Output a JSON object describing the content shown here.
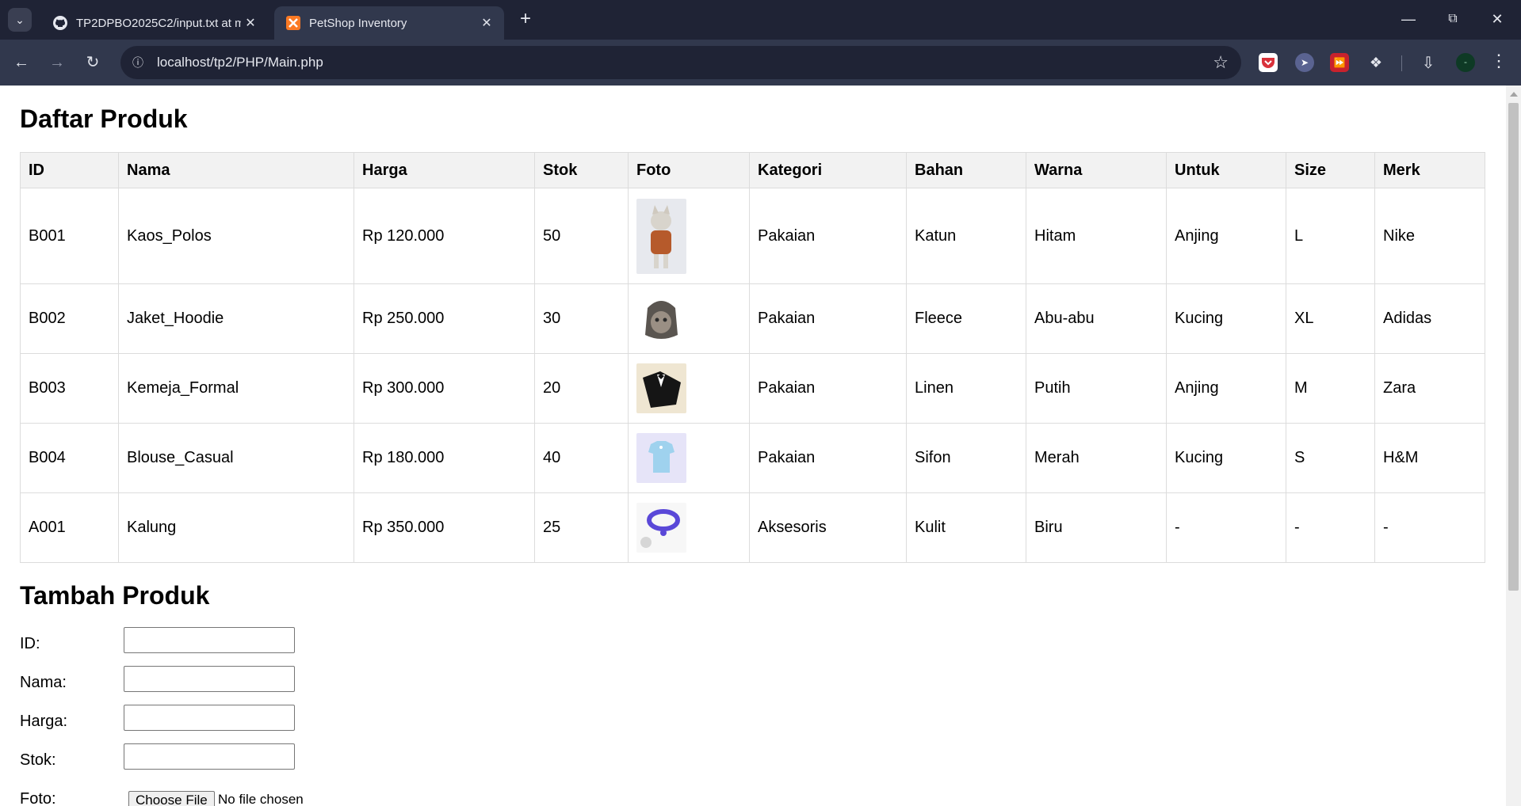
{
  "browser": {
    "tabs": [
      {
        "title": "TP2DPBO2025C2/input.txt at m",
        "active": false,
        "icon": "github-icon"
      },
      {
        "title": "PetShop Inventory",
        "active": true,
        "icon": "xampp-icon"
      }
    ],
    "url": "localhost/tp2/PHP/Main.php",
    "profile_initial": "-"
  },
  "page": {
    "list_title": "Daftar Produk",
    "add_title": "Tambah Produk",
    "columns": [
      "ID",
      "Nama",
      "Harga",
      "Stok",
      "Foto",
      "Kategori",
      "Bahan",
      "Warna",
      "Untuk",
      "Size",
      "Merk"
    ],
    "rows": [
      {
        "id": "B001",
        "nama": "Kaos_Polos",
        "harga": "Rp 120.000",
        "stok": "50",
        "foto": "cat-in-shirt-photo",
        "kategori": "Pakaian",
        "bahan": "Katun",
        "warna": "Hitam",
        "untuk": "Anjing",
        "size": "L",
        "merk": "Nike"
      },
      {
        "id": "B002",
        "nama": "Jaket_Hoodie",
        "harga": "Rp 250.000",
        "stok": "30",
        "foto": "cat-hoodie-photo",
        "kategori": "Pakaian",
        "bahan": "Fleece",
        "warna": "Abu-abu",
        "untuk": "Kucing",
        "size": "XL",
        "merk": "Adidas"
      },
      {
        "id": "B003",
        "nama": "Kemeja_Formal",
        "harga": "Rp 300.000",
        "stok": "20",
        "foto": "tuxedo-shirt-photo",
        "kategori": "Pakaian",
        "bahan": "Linen",
        "warna": "Putih",
        "untuk": "Anjing",
        "size": "M",
        "merk": "Zara"
      },
      {
        "id": "B004",
        "nama": "Blouse_Casual",
        "harga": "Rp 180.000",
        "stok": "40",
        "foto": "blue-blouse-photo",
        "kategori": "Pakaian",
        "bahan": "Sifon",
        "warna": "Merah",
        "untuk": "Kucing",
        "size": "S",
        "merk": "H&M"
      },
      {
        "id": "A001",
        "nama": "Kalung",
        "harga": "Rp 350.000",
        "stok": "25",
        "foto": "collar-photo",
        "kategori": "Aksesoris",
        "bahan": "Kulit",
        "warna": "Biru",
        "untuk": "-",
        "size": "-",
        "merk": "-"
      }
    ],
    "form": {
      "id_label": "ID:",
      "nama_label": "Nama:",
      "harga_label": "Harga:",
      "stok_label": "Stok:",
      "foto_label": "Foto:",
      "file_button": "Choose File",
      "file_status": "No file chosen"
    }
  }
}
